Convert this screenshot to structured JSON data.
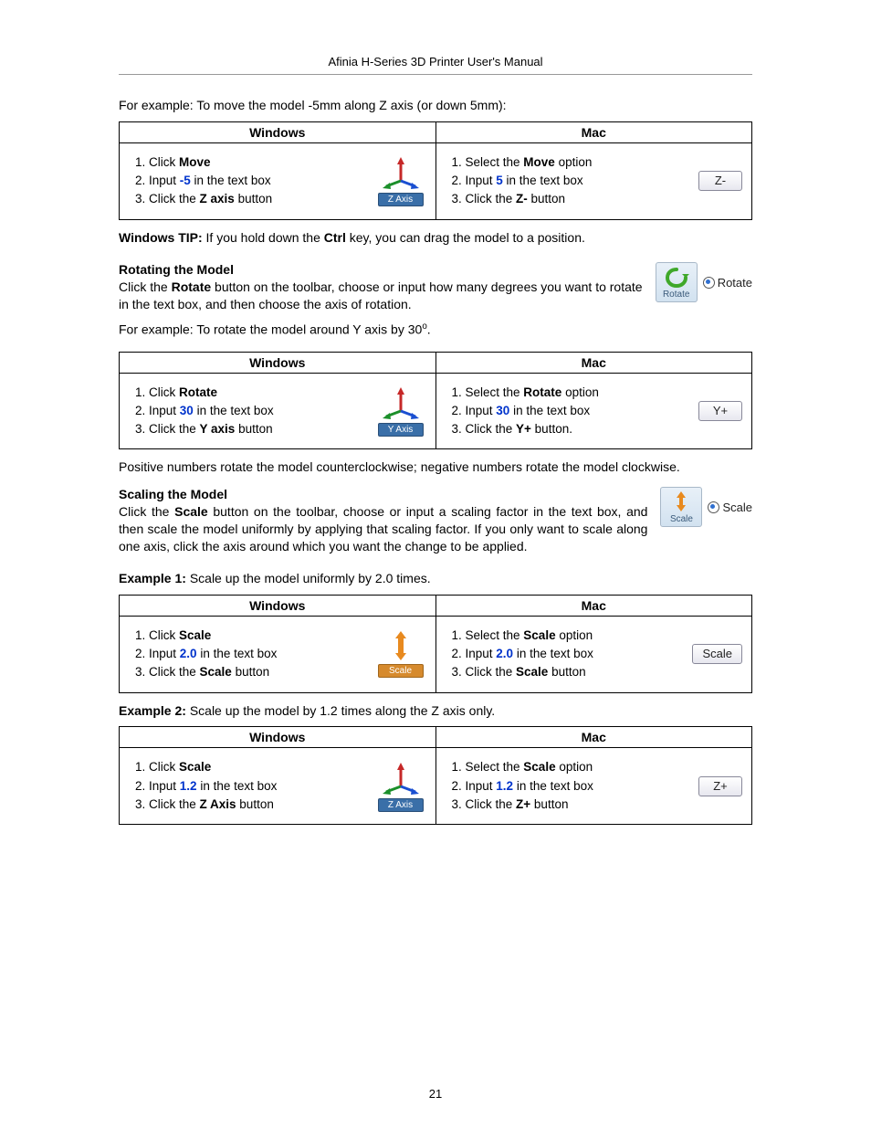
{
  "header": {
    "title": "Afinia H-Series 3D Printer User's Manual"
  },
  "page_number": "21",
  "intro_move": "For example: To move the model -5mm along Z axis (or down 5mm):",
  "col": {
    "windows": "Windows",
    "mac": "Mac"
  },
  "move_table": {
    "win": {
      "s1_pre": "Click ",
      "s1_b": "Move",
      "s2_pre": "Input ",
      "s2_val": "-5",
      "s2_post": " in the text box",
      "s3_pre": "Click the ",
      "s3_b": "Z axis",
      "s3_post": " button",
      "btn_caption": "Z Axis"
    },
    "mac": {
      "s1_pre": "Select the ",
      "s1_b": "Move",
      "s1_post": " option",
      "s2_pre": "Input ",
      "s2_val": "5",
      "s2_post": " in the text box",
      "s3_pre": "Click the ",
      "s3_b": "Z-",
      "s3_post": " button",
      "btn_label": "Z-"
    }
  },
  "tip": {
    "label": "Windows TIP:",
    "pre": "   If you hold down the ",
    "key": "Ctrl",
    "post": " key, you can drag the model to a position."
  },
  "rotate": {
    "heading": "Rotating the Model",
    "p_pre": "Click the ",
    "p_b": "Rotate",
    "p_post": " button on the toolbar, choose or input how many degrees you want to rotate in the text box, and then choose the axis of rotation.",
    "example_pre": "For example: To rotate the model around Y axis by 30",
    "example_deg": "o",
    "example_post": ".",
    "side_label": "Rotate",
    "side_radio": "Rotate"
  },
  "rotate_table": {
    "win": {
      "s1_pre": "Click ",
      "s1_b": "Rotate",
      "s2_pre": "Input ",
      "s2_val": "30",
      "s2_post": " in the text box",
      "s3_pre": "Click the ",
      "s3_b": "Y axis",
      "s3_post": " button",
      "btn_caption": "Y Axis"
    },
    "mac": {
      "s1_pre": "Select the ",
      "s1_b": "Rotate",
      "s1_post": " option",
      "s2_pre": "Input ",
      "s2_val": "30",
      "s2_post": " in the text box",
      "s3_pre": "Click the ",
      "s3_b": "Y+",
      "s3_post": " button.",
      "btn_label": "Y+"
    }
  },
  "rotate_note": "Positive numbers rotate the model counterclockwise; negative numbers rotate the model clockwise.",
  "scale": {
    "heading": "Scaling the Model",
    "p_pre": "Click the ",
    "p_b": "Scale",
    "p_post": " button on the toolbar, choose or input a scaling factor in the text box, and then scale the model uniformly by applying that scaling factor. If you only want to scale along one axis, click the axis around which you want the change to be applied.",
    "side_label": "Scale",
    "side_radio": "Scale"
  },
  "ex1": {
    "label": "Example 1:",
    "text": " Scale up the model uniformly by 2.0 times."
  },
  "scale1_table": {
    "win": {
      "s1_pre": "Click ",
      "s1_b": "Scale",
      "s2_pre": "Input ",
      "s2_val": "2.0",
      "s2_post": " in the text box",
      "s3_pre": "Click the ",
      "s3_b": "Scale",
      "s3_post": " button",
      "btn_caption": "Scale"
    },
    "mac": {
      "s1_pre": "Select the ",
      "s1_b": "Scale",
      "s1_post": " option",
      "s2_pre": "Input ",
      "s2_val": "2.0",
      "s2_post": " in the text box",
      "s3_pre": "Click the ",
      "s3_b": "Scale",
      "s3_post": " button",
      "btn_label": "Scale"
    }
  },
  "ex2": {
    "label": "Example 2:",
    "text": " Scale up the model by 1.2 times along the Z axis only."
  },
  "scale2_table": {
    "win": {
      "s1_pre": "Click ",
      "s1_b": "Scale",
      "s2_pre": "Input ",
      "s2_val": "1.2",
      "s2_post": " in the text box",
      "s3_pre": "Click the ",
      "s3_b": "Z Axis",
      "s3_post": " button",
      "btn_caption": "Z Axis"
    },
    "mac": {
      "s1_pre": "Select the ",
      "s1_b": "Scale",
      "s1_post": " option",
      "s2_pre": "Input ",
      "s2_val": "1.2",
      "s2_post": " in the text box",
      "s3_pre": "Click the ",
      "s3_b": "Z+",
      "s3_post": " button",
      "btn_label": "Z+"
    }
  }
}
